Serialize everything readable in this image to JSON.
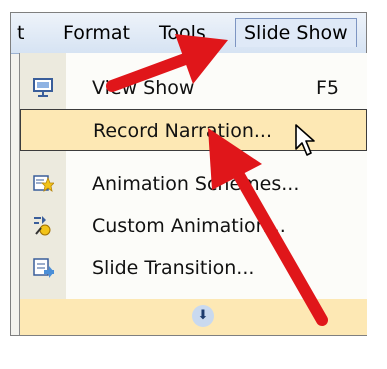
{
  "menubar": {
    "items": [
      {
        "label": "t"
      },
      {
        "label": "Format"
      },
      {
        "label": "Tools"
      },
      {
        "label": "Slide Show"
      }
    ]
  },
  "dropdown": {
    "items": [
      {
        "label": "View Show",
        "shortcut": "F5",
        "icon": "projector-icon",
        "highlighted": false
      },
      {
        "label": "Record Narration...",
        "shortcut": "",
        "icon": "",
        "highlighted": true
      },
      {
        "label": "Animation Schemes...",
        "shortcut": "",
        "icon": "animation-schemes-icon",
        "highlighted": false
      },
      {
        "label": "Custom Animation...",
        "shortcut": "",
        "icon": "custom-animation-icon",
        "highlighted": false
      },
      {
        "label": "Slide Transition...",
        "shortcut": "",
        "icon": "slide-transition-icon",
        "highlighted": false
      }
    ],
    "expand_icon": "chevron-double-down-icon"
  },
  "colors": {
    "highlight": "#fde8b4",
    "arrow": "#e0161a",
    "menubar": "#d6e3f3"
  }
}
